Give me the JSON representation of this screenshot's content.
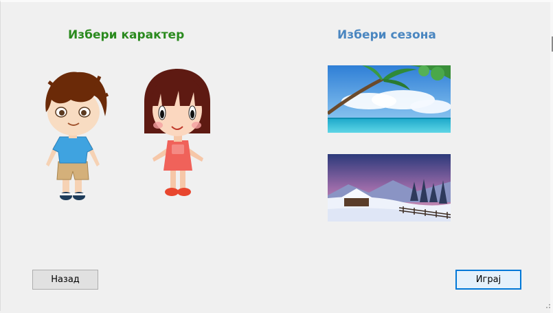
{
  "headings": {
    "character": "Избери карактер",
    "season": "Избери сезона"
  },
  "characters": [
    {
      "name": "boy",
      "icon": "boy-character"
    },
    {
      "name": "girl",
      "icon": "girl-character"
    }
  ],
  "seasons": [
    {
      "name": "summer",
      "icon": "summer-beach-image"
    },
    {
      "name": "winter",
      "icon": "winter-snow-image"
    }
  ],
  "buttons": {
    "back": "Назад",
    "play": "Играј"
  },
  "colors": {
    "character_heading": "#2a8a1e",
    "season_heading": "#4a86c0",
    "play_border": "#0078d7"
  }
}
